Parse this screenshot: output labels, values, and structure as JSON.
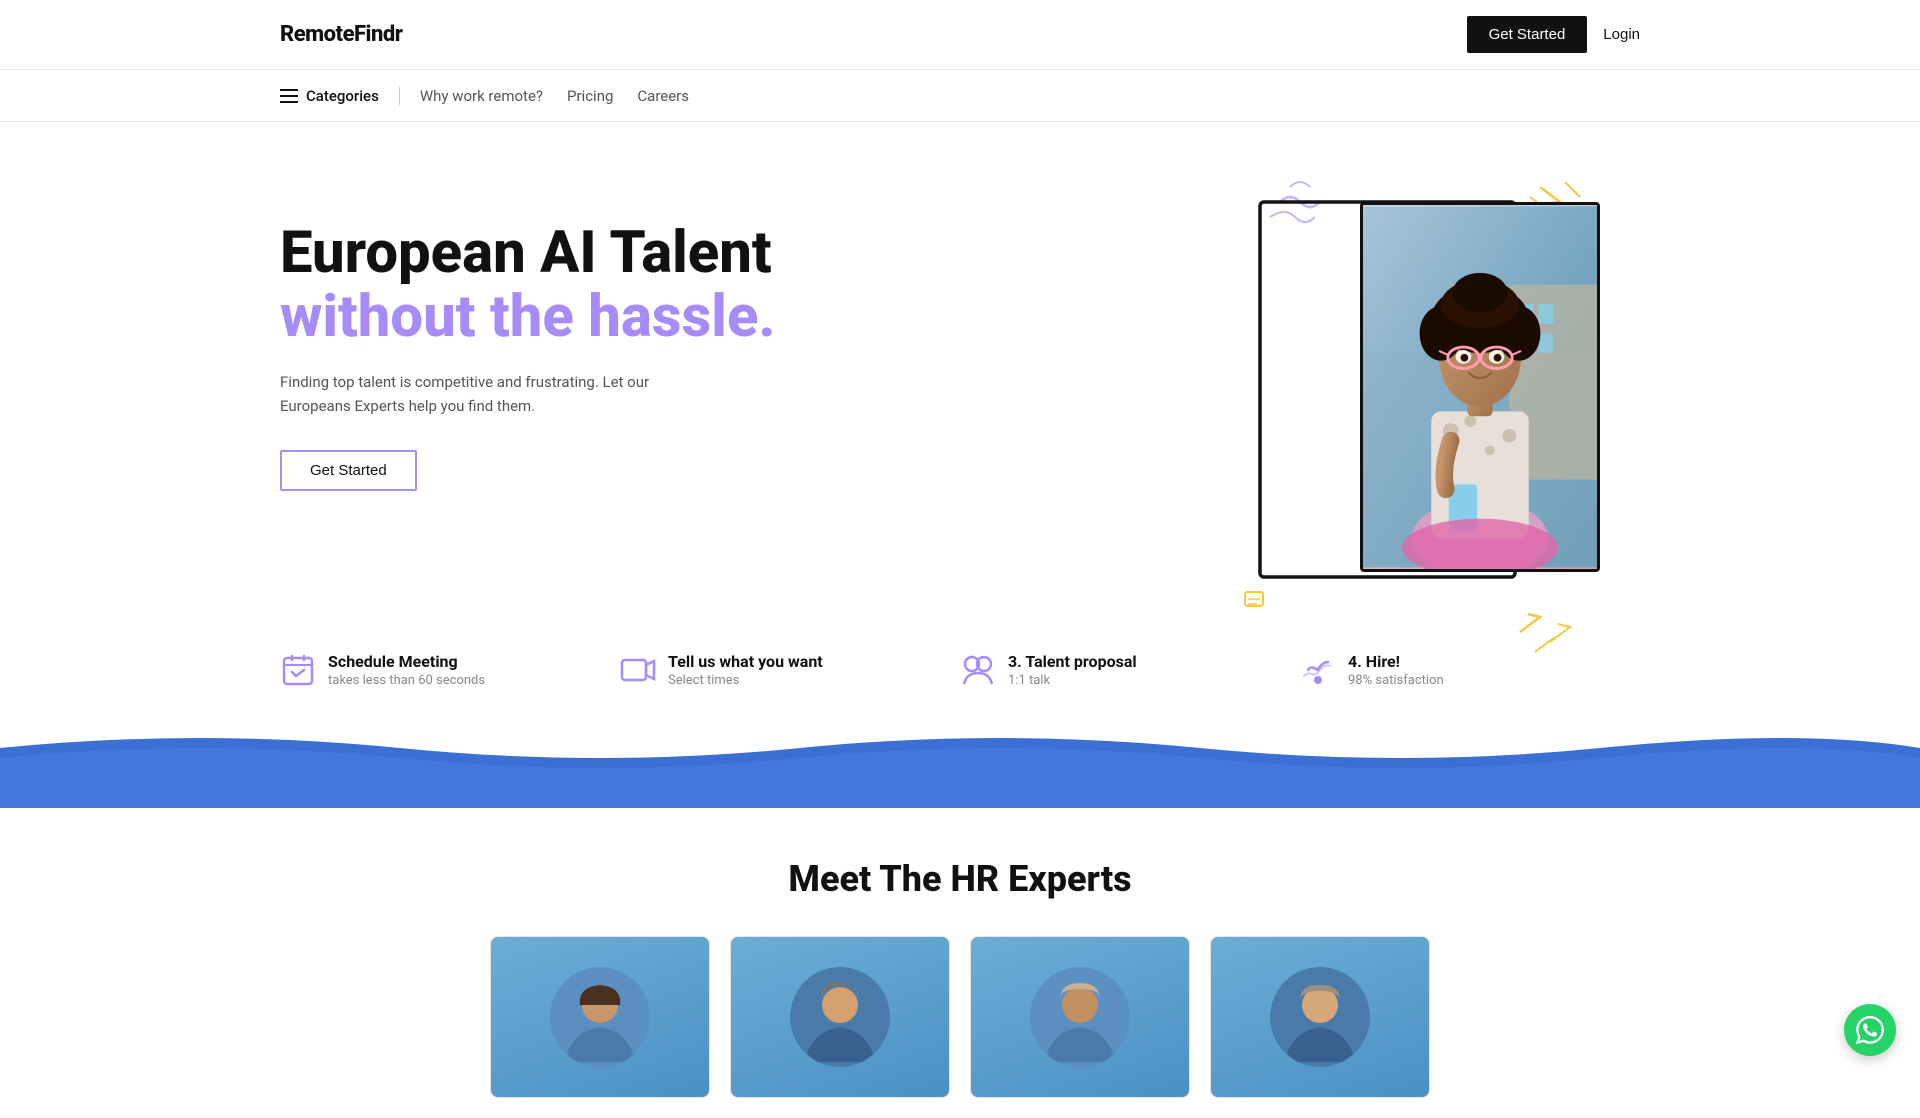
{
  "header": {
    "logo": "RemoteFindr",
    "get_started_label": "Get Started",
    "login_label": "Login"
  },
  "nav": {
    "categories_label": "Categories",
    "links": [
      {
        "label": "Why work remote?",
        "href": "#"
      },
      {
        "label": "Pricing",
        "href": "#"
      },
      {
        "label": "Careers",
        "href": "#"
      }
    ]
  },
  "hero": {
    "title_line1": "European AI Talent",
    "title_line2": "without the hassle.",
    "subtitle": "Finding top talent is competitive and frustrating. Let our Europeans Experts help you find them.",
    "cta_label": "Get Started"
  },
  "steps": [
    {
      "icon": "📅",
      "title": "Schedule Meeting",
      "desc": "takes less than 60 seconds"
    },
    {
      "icon": "🎥",
      "title": "Tell us what you want",
      "desc": "Select times"
    },
    {
      "icon": "👥",
      "title": "3. Talent proposal",
      "desc": "1:1 talk"
    },
    {
      "icon": "🤝",
      "title": "4. Hire!",
      "desc": "98% satisfaction"
    }
  ],
  "hr_section": {
    "title": "Meet The HR Experts"
  },
  "experts": [
    {
      "id": 1,
      "bg": "#5a8fbf"
    },
    {
      "id": 2,
      "bg": "#4a7aaa"
    },
    {
      "id": 3,
      "bg": "#5a8fbf"
    },
    {
      "id": 4,
      "bg": "#4a7aaa"
    }
  ],
  "colors": {
    "accent_purple": "#a78bfa",
    "accent_blue": "#3b6fd4",
    "wave_color": "#3b6fd4",
    "cta_bg": "#111111"
  }
}
